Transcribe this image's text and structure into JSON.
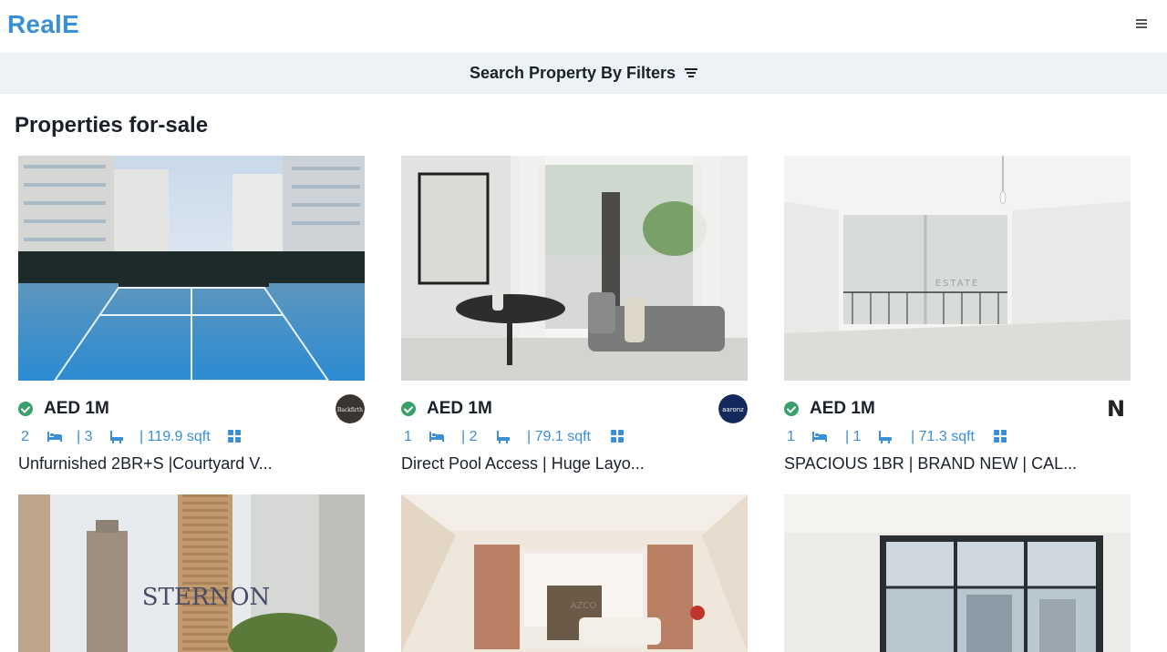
{
  "header": {
    "logo": "RealE"
  },
  "filters": {
    "label": "Search Property By Filters"
  },
  "page": {
    "heading": "Properties for-sale"
  },
  "colors": {
    "brand": "#3b8fd6",
    "verified": "#38a169",
    "filter_bar": "#edf2f7"
  },
  "listings": [
    {
      "price": "AED 1M",
      "rooms": "2",
      "baths": "| 3",
      "area": "| 119.9 sqft",
      "title": "Unfurnished 2BR+S |Courtyard V...",
      "agency": "Backfirth",
      "photo_watermark": ""
    },
    {
      "price": "AED 1M",
      "rooms": "1",
      "baths": "| 2",
      "area": "| 79.1 sqft",
      "title": "Direct Pool Access | Huge Layo...",
      "agency": "aaronz",
      "photo_watermark": ""
    },
    {
      "price": "AED 1M",
      "rooms": "1",
      "baths": "| 1",
      "area": "| 71.3 sqft",
      "title": "SPACIOUS 1BR | BRAND NEW | CAL...",
      "agency": "N",
      "photo_watermark": "ESTATE"
    },
    {
      "photo_watermark": "STERNON"
    },
    {
      "photo_watermark": "AZCO"
    },
    {
      "photo_watermark": ""
    }
  ]
}
